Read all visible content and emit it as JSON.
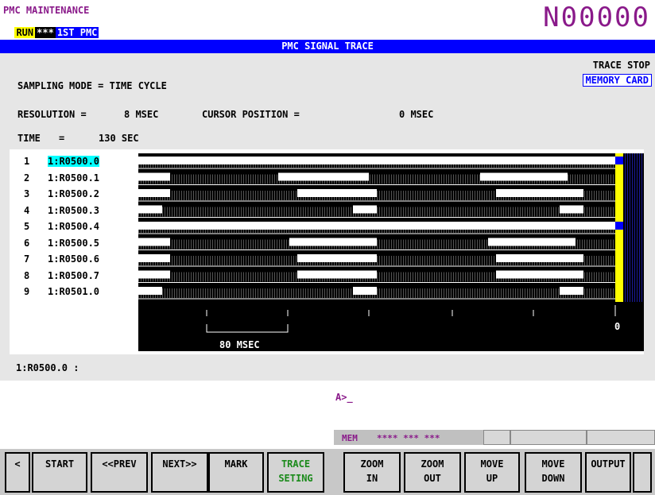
{
  "header": {
    "mode_title": "PMC MAINTENANCE",
    "run": "RUN",
    "stars": "***",
    "pmc": "1ST PMC",
    "program_number": "N00000"
  },
  "title": "PMC SIGNAL TRACE",
  "status": {
    "trace_state": "TRACE STOP",
    "device": "MEMORY CARD"
  },
  "settings": {
    "sampling_mode": "SAMPLING MODE = TIME CYCLE",
    "resolution_label": "RESOLUTION =",
    "resolution_value": "8 MSEC",
    "cursor_label": "CURSOR POSITION =",
    "cursor_value": "0 MSEC",
    "time_label": "TIME",
    "time_eq": "=",
    "time_value": "130 SEC"
  },
  "signals": [
    {
      "num": "1",
      "addr": "1:R0500.0"
    },
    {
      "num": "2",
      "addr": "1:R0500.1"
    },
    {
      "num": "3",
      "addr": "1:R0500.2"
    },
    {
      "num": "4",
      "addr": "1:R0500.3"
    },
    {
      "num": "5",
      "addr": "1:R0500.4"
    },
    {
      "num": "6",
      "addr": "1:R0500.5"
    },
    {
      "num": "7",
      "addr": "1:R0500.6"
    },
    {
      "num": "8",
      "addr": "1:R0500.7"
    },
    {
      "num": "9",
      "addr": "1:R0501.0"
    }
  ],
  "scale": {
    "span_label": "80 MSEC",
    "cursor_mark": "0"
  },
  "selected_signal_readout": "1:R0500.0 :",
  "input": {
    "prompt": "A>_"
  },
  "memline": {
    "mode": "MEM",
    "stars": "**** *** ***"
  },
  "softkeys": [
    {
      "label": "<"
    },
    {
      "label": "START"
    },
    {
      "label": "<<PREV"
    },
    {
      "label": "NEXT>>"
    },
    {
      "label": "MARK"
    },
    {
      "label": "TRACE\nSETING"
    },
    {
      "label": "ZOOM\nIN"
    },
    {
      "label": "ZOOM\nOUT"
    },
    {
      "label": "MOVE\nUP"
    },
    {
      "label": "MOVE\nDOWN"
    },
    {
      "label": "OUTPUT"
    },
    {
      "label": ""
    }
  ],
  "colors": {
    "accent_magenta": "#8a1a8a",
    "titlebar_blue": "#0000ff",
    "cursor_yellow": "#ffff00",
    "selection_cyan": "#00ffff",
    "softkey_green": "#1a8a1a"
  }
}
